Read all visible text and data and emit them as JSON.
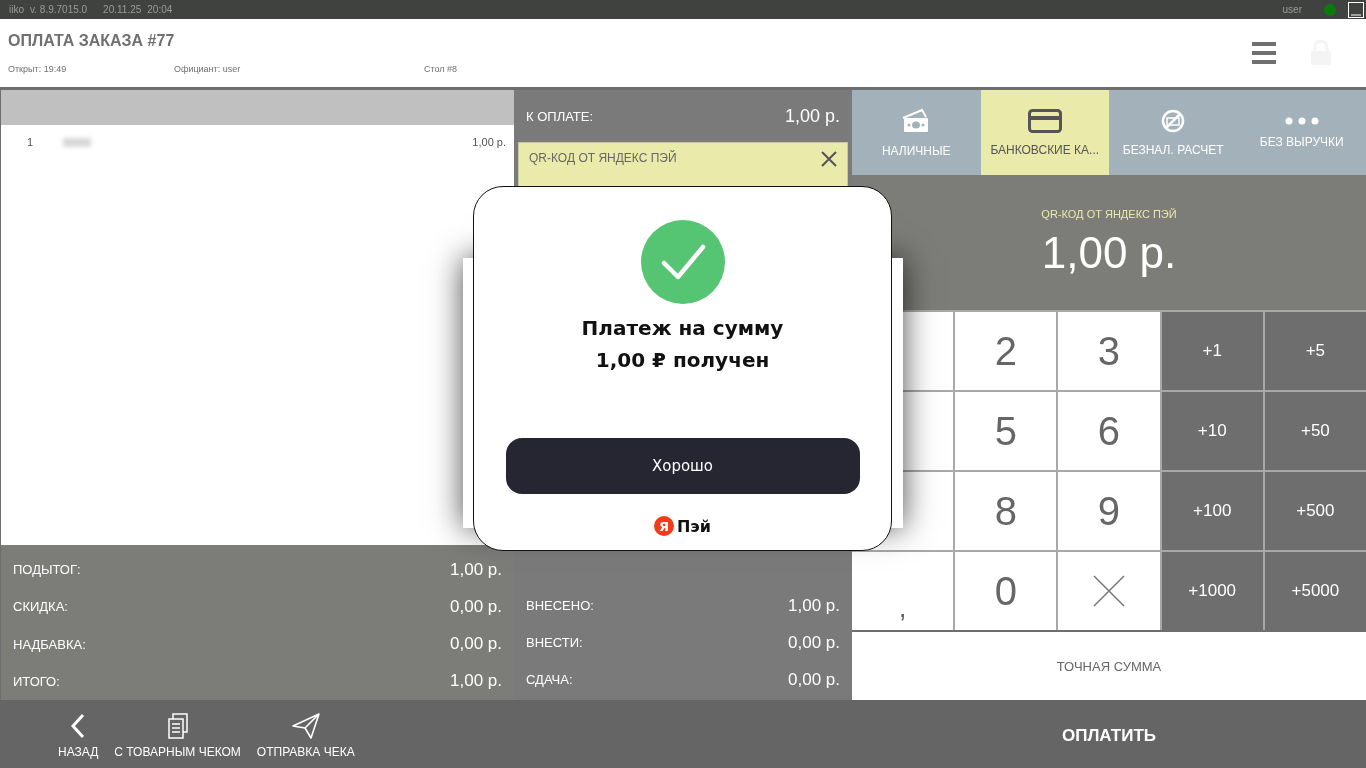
{
  "top_bar": {
    "app": "iiko",
    "version": "v. 8.9.7015.0",
    "date": "20.11.25",
    "time": "20:04",
    "user": "user",
    "online": true
  },
  "header": {
    "title": "ОПЛАТА ЗАКАЗА #77",
    "opened": "Открыт: 19:49",
    "waiter": "Официант: user",
    "table": "Стол #8"
  },
  "order": {
    "items": [
      {
        "number": "1",
        "price": "1,00 р."
      }
    ]
  },
  "totals": [
    {
      "label": "ПОДЫТОГ:",
      "value": "1,00 р."
    },
    {
      "label": "СКИДКА:",
      "value": "0,00 р."
    },
    {
      "label": "НАДБАВКА:",
      "value": "0,00 р."
    },
    {
      "label": "ИТОГО:",
      "value": "1,00 р."
    }
  ],
  "payment": {
    "due_label": "К ОПЛАТЕ:",
    "due_value": "1,00 р.",
    "method": "QR-КОД ОТ ЯНДЕКС ПЭЙ"
  },
  "balances": [
    {
      "label": "ВНЕСЕНО:",
      "value": "1,00 р."
    },
    {
      "label": "ВНЕСТИ:",
      "value": "0,00 р."
    },
    {
      "label": "СДАЧА:",
      "value": "0,00 р."
    }
  ],
  "payment_types": [
    {
      "kind": "cash",
      "label": "НАЛИЧНЫЕ",
      "selected": false
    },
    {
      "kind": "card",
      "label": "БАНКОВСКИЕ КА...",
      "selected": true
    },
    {
      "kind": "cashless",
      "label": "БЕЗНАЛ. РАСЧЕТ",
      "selected": false
    },
    {
      "kind": "more",
      "label": "БЕЗ ВЫРУЧКИ",
      "selected": false
    }
  ],
  "amount_display": {
    "method": "QR-КОД ОТ ЯНДЕКС ПЭЙ",
    "amount": "1,00 р."
  },
  "keypad": [
    {
      "kind": "covered"
    },
    {
      "kind": "digit",
      "label": "2"
    },
    {
      "kind": "digit",
      "label": "3"
    },
    {
      "kind": "add",
      "label": "+1"
    },
    {
      "kind": "add",
      "label": "+5"
    },
    {
      "kind": "covered"
    },
    {
      "kind": "digit",
      "label": "5"
    },
    {
      "kind": "digit",
      "label": "6"
    },
    {
      "kind": "add",
      "label": "+10"
    },
    {
      "kind": "add",
      "label": "+50"
    },
    {
      "kind": "covered"
    },
    {
      "kind": "digit",
      "label": "8"
    },
    {
      "kind": "digit",
      "label": "9"
    },
    {
      "kind": "add",
      "label": "+100"
    },
    {
      "kind": "add",
      "label": "+500"
    },
    {
      "kind": "comma",
      "label": ","
    },
    {
      "kind": "digit",
      "label": "0"
    },
    {
      "kind": "backspace"
    },
    {
      "kind": "add",
      "label": "+1000"
    },
    {
      "kind": "add",
      "label": "+5000"
    }
  ],
  "exact_amount_button": "ТОЧНАЯ СУММА",
  "toolbar": [
    {
      "kind": "back",
      "label": "НАЗАД"
    },
    {
      "kind": "receipt",
      "label": "С ТОВАРНЫМ ЧЕКОМ"
    },
    {
      "kind": "send",
      "label": "ОТПРАВКА ЧЕКА"
    }
  ],
  "pay_button": "ОПЛАТИТЬ",
  "dialog": {
    "message": "Платеж на сумму 1,00 ₽ получен",
    "button": "Хорошо",
    "brand_mark": "Я",
    "brand": "Пэй"
  }
}
